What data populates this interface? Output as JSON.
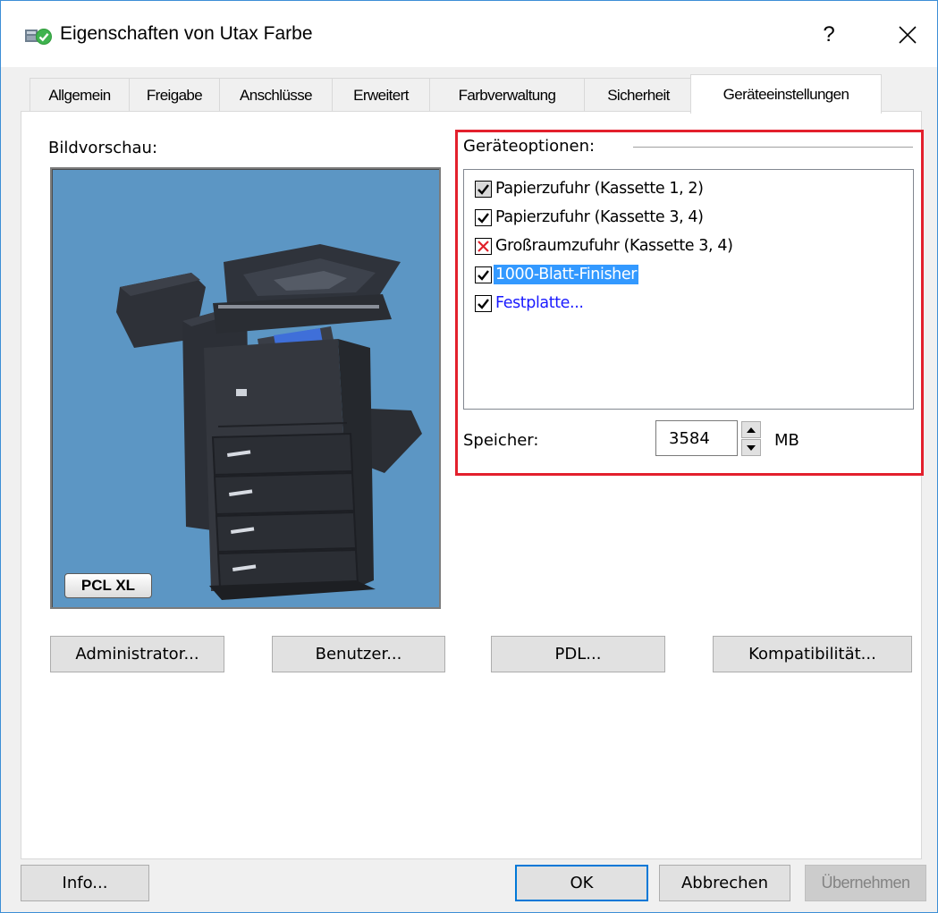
{
  "window": {
    "title": "Eigenschaften von Utax Farbe",
    "help": "?",
    "close_icon": "close-icon"
  },
  "tabs": [
    {
      "label": "Allgemein",
      "active": false
    },
    {
      "label": "Freigabe",
      "active": false
    },
    {
      "label": "Anschlüsse",
      "active": false
    },
    {
      "label": "Erweitert",
      "active": false
    },
    {
      "label": "Farbverwaltung",
      "active": false
    },
    {
      "label": "Sicherheit",
      "active": false
    },
    {
      "label": "Geräteeinstellungen",
      "active": true
    }
  ],
  "preview": {
    "label": "Bildvorschau:",
    "badge": "PCL XL",
    "background": "#5c96c4"
  },
  "device_options": {
    "label": "Geräteoptionen:",
    "highlight_color": "#e3202d",
    "items": [
      {
        "label": "Papierzufuhr (Kassette 1, 2)",
        "state": "checked-disabled",
        "style": "normal"
      },
      {
        "label": "Papierzufuhr (Kassette 3, 4)",
        "state": "checked",
        "style": "normal"
      },
      {
        "label": "Großraumzufuhr (Kassette 3, 4)",
        "state": "conflict",
        "style": "normal"
      },
      {
        "label": "1000-Blatt-Finisher",
        "state": "checked",
        "style": "selected"
      },
      {
        "label": "Festplatte...",
        "state": "checked",
        "style": "link"
      }
    ]
  },
  "memory": {
    "label": "Speicher:",
    "value": "3584",
    "unit": "MB"
  },
  "actions": {
    "administrator": "Administrator...",
    "user": "Benutzer...",
    "pdl": "PDL...",
    "compatibility": "Kompatibilität..."
  },
  "footer": {
    "info": "Info...",
    "ok": "OK",
    "cancel": "Abbrechen",
    "apply": "Übernehmen"
  }
}
